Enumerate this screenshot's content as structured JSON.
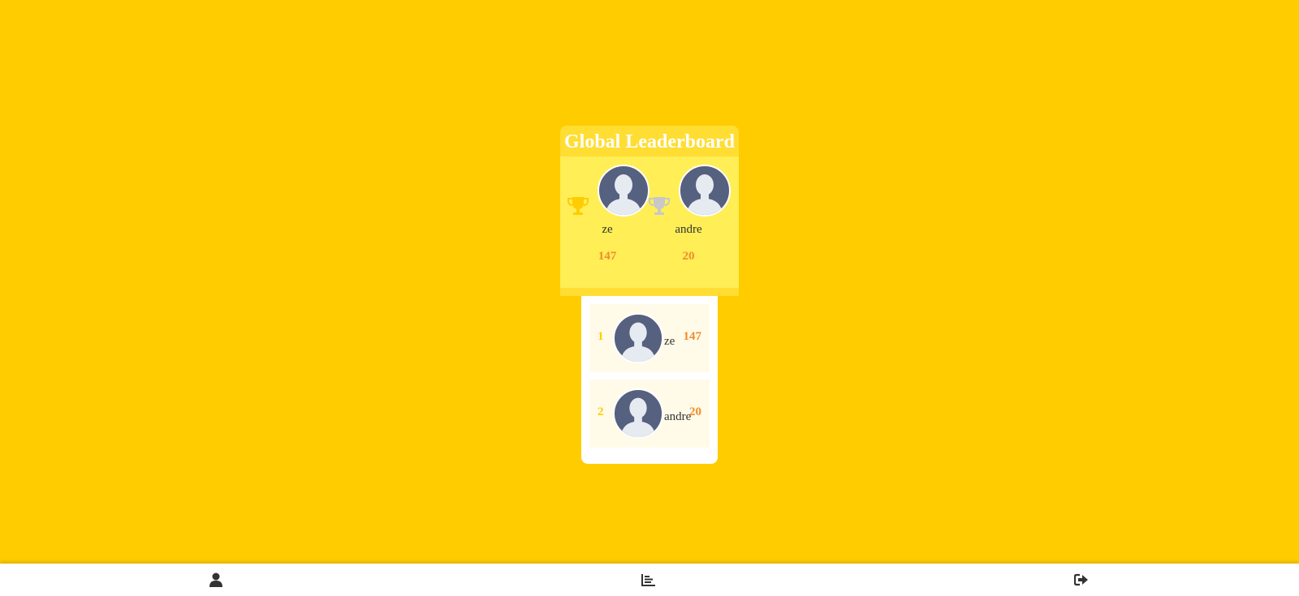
{
  "leaderboard": {
    "title": "Global Leaderboard",
    "podium": [
      {
        "name": "ze",
        "score": "147",
        "trophy": "gold-trophy-icon"
      },
      {
        "name": "andre",
        "score": "20",
        "trophy": "silver-trophy-icon"
      }
    ],
    "list": [
      {
        "rank": "1",
        "name": "ze",
        "score": "147"
      },
      {
        "rank": "2",
        "name": "andre",
        "score": "20"
      }
    ]
  },
  "nav": {
    "items": [
      {
        "icon": "user-icon"
      },
      {
        "icon": "bar-chart-icon"
      },
      {
        "icon": "sign-out-icon"
      }
    ]
  },
  "colors": {
    "background": "#ffcc00",
    "gold": "#ffcc00",
    "silver": "#c8c8c8",
    "score": "#f08c2e",
    "avatar": "#56607f"
  }
}
